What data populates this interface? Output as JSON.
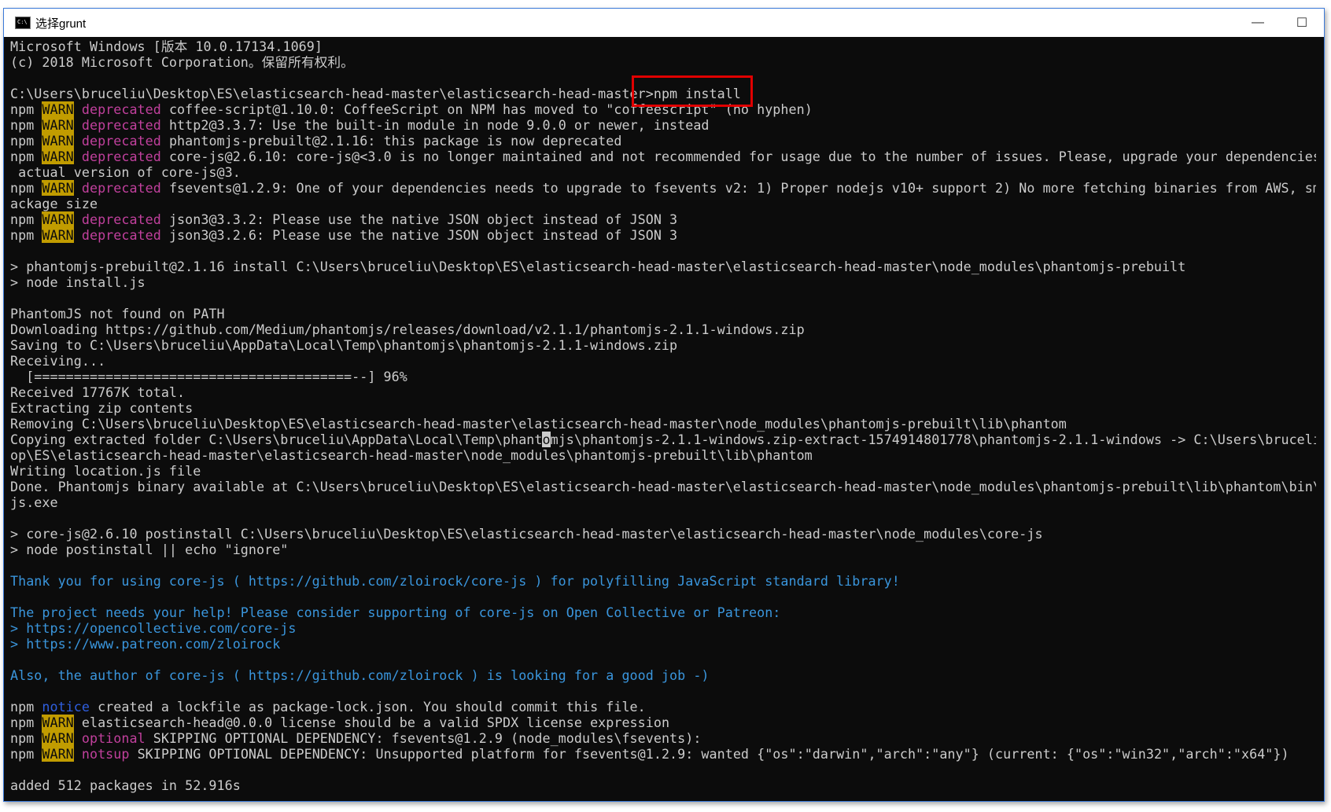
{
  "window": {
    "title": "选择grunt",
    "icon": "cmd-icon",
    "minimize": "—",
    "maximize": "☐"
  },
  "console": {
    "lines": [
      {
        "text": "Microsoft Windows [版本 10.0.17134.1069]"
      },
      {
        "text": "(c) 2018 Microsoft Corporation。保留所有权利。"
      },
      {
        "text": ""
      },
      {
        "prompt": "C:\\Users\\bruceliu\\Desktop\\ES\\elasticsearch-head-master\\elasticsearch-head-master>",
        "cmd": "npm install"
      },
      {
        "warn": "deprecated",
        "text": " coffee-script@1.10.0: CoffeeScript on NPM has moved to \"coffeescript\" (no hyphen)"
      },
      {
        "warn": "deprecated",
        "text": " http2@3.3.7: Use the built-in module in node 9.0.0 or newer, instead"
      },
      {
        "warn": "deprecated",
        "text": " phantomjs-prebuilt@2.1.16: this package is now deprecated"
      },
      {
        "warn": "deprecated",
        "text": " core-js@2.6.10: core-js@<3.0 is no longer maintained and not recommended for usage due to the number of issues. Please, upgrade your dependencies t"
      },
      {
        "text": " actual version of core-js@3."
      },
      {
        "warn": "deprecated",
        "text": " fsevents@1.2.9: One of your dependencies needs to upgrade to fsevents v2: 1) Proper nodejs v10+ support 2) No more fetching binaries from AWS, smal"
      },
      {
        "text": "ackage size"
      },
      {
        "warn": "deprecated",
        "text": " json3@3.3.2: Please use the native JSON object instead of JSON 3"
      },
      {
        "warn": "deprecated",
        "text": " json3@3.2.6: Please use the native JSON object instead of JSON 3"
      },
      {
        "text": ""
      },
      {
        "text": "> phantomjs-prebuilt@2.1.16 install C:\\Users\\bruceliu\\Desktop\\ES\\elasticsearch-head-master\\elasticsearch-head-master\\node_modules\\phantomjs-prebuilt"
      },
      {
        "text": "> node install.js"
      },
      {
        "text": ""
      },
      {
        "text": "PhantomJS not found on PATH"
      },
      {
        "text": "Downloading https://github.com/Medium/phantomjs/releases/download/v2.1.1/phantomjs-2.1.1-windows.zip"
      },
      {
        "text": "Saving to C:\\Users\\bruceliu\\AppData\\Local\\Temp\\phantomjs\\phantomjs-2.1.1-windows.zip"
      },
      {
        "text": "Receiving..."
      },
      {
        "text": "  [========================================--] 96%"
      },
      {
        "text": "Received 17767K total."
      },
      {
        "text": "Extracting zip contents"
      },
      {
        "text": "Removing C:\\Users\\bruceliu\\Desktop\\ES\\elasticsearch-head-master\\elasticsearch-head-master\\node_modules\\phantomjs-prebuilt\\lib\\phantom"
      },
      {
        "pre": "Copying extracted folder C:\\Users\\bruceliu\\AppData\\Local\\Temp\\phant",
        "cursor": "o",
        "post": "mjs\\phantomjs-2.1.1-windows.zip-extract-1574914801778\\phantomjs-2.1.1-windows -> C:\\Users\\bruceliu\\"
      },
      {
        "text": "op\\ES\\elasticsearch-head-master\\elasticsearch-head-master\\node_modules\\phantomjs-prebuilt\\lib\\phantom"
      },
      {
        "text": "Writing location.js file"
      },
      {
        "text": "Done. Phantomjs binary available at C:\\Users\\bruceliu\\Desktop\\ES\\elasticsearch-head-master\\elasticsearch-head-master\\node_modules\\phantomjs-prebuilt\\lib\\phantom\\bin\\ph"
      },
      {
        "text": "js.exe"
      },
      {
        "text": ""
      },
      {
        "text": "> core-js@2.6.10 postinstall C:\\Users\\bruceliu\\Desktop\\ES\\elasticsearch-head-master\\elasticsearch-head-master\\node_modules\\core-js"
      },
      {
        "text": "> node postinstall || echo \"ignore\""
      },
      {
        "text": ""
      },
      {
        "cyan": "Thank you for using core-js ( https://github.com/zloirock/core-js ) for polyfilling JavaScript standard library!"
      },
      {
        "text": ""
      },
      {
        "cyan": "The project needs your help! Please consider supporting of core-js on Open Collective or Patreon:"
      },
      {
        "cyan": "> https://opencollective.com/core-js"
      },
      {
        "cyan": "> https://www.patreon.com/zloirock"
      },
      {
        "text": ""
      },
      {
        "cyan": "Also, the author of core-js ( https://github.com/zloirock ) is looking for a good job -)"
      },
      {
        "text": ""
      },
      {
        "notice": "notice",
        "text": " created a lockfile as package-lock.json. You should commit this file."
      },
      {
        "warn": "",
        "text": " elasticsearch-head@0.0.0 license should be a valid SPDX license expression"
      },
      {
        "warn": "optional",
        "text": " SKIPPING OPTIONAL DEPENDENCY: fsevents@1.2.9 (node_modules\\fsevents):"
      },
      {
        "warn": "notsup",
        "text": " SKIPPING OPTIONAL DEPENDENCY: Unsupported platform for fsevents@1.2.9: wanted {\"os\":\"darwin\",\"arch\":\"any\"} (current: {\"os\":\"win32\",\"arch\":\"x64\"})"
      },
      {
        "text": ""
      },
      {
        "text": "added 512 packages in 52.916s"
      }
    ]
  },
  "labels": {
    "npm": "npm",
    "warn": "WARN"
  },
  "colors": {
    "background": "#0c0c0c",
    "text": "#cccccc",
    "warn_bg": "#c19c00",
    "deprecated": "#c1409d",
    "notice": "#2f5fe0",
    "cyan": "#3a96dd",
    "highlight": "#e00000"
  }
}
